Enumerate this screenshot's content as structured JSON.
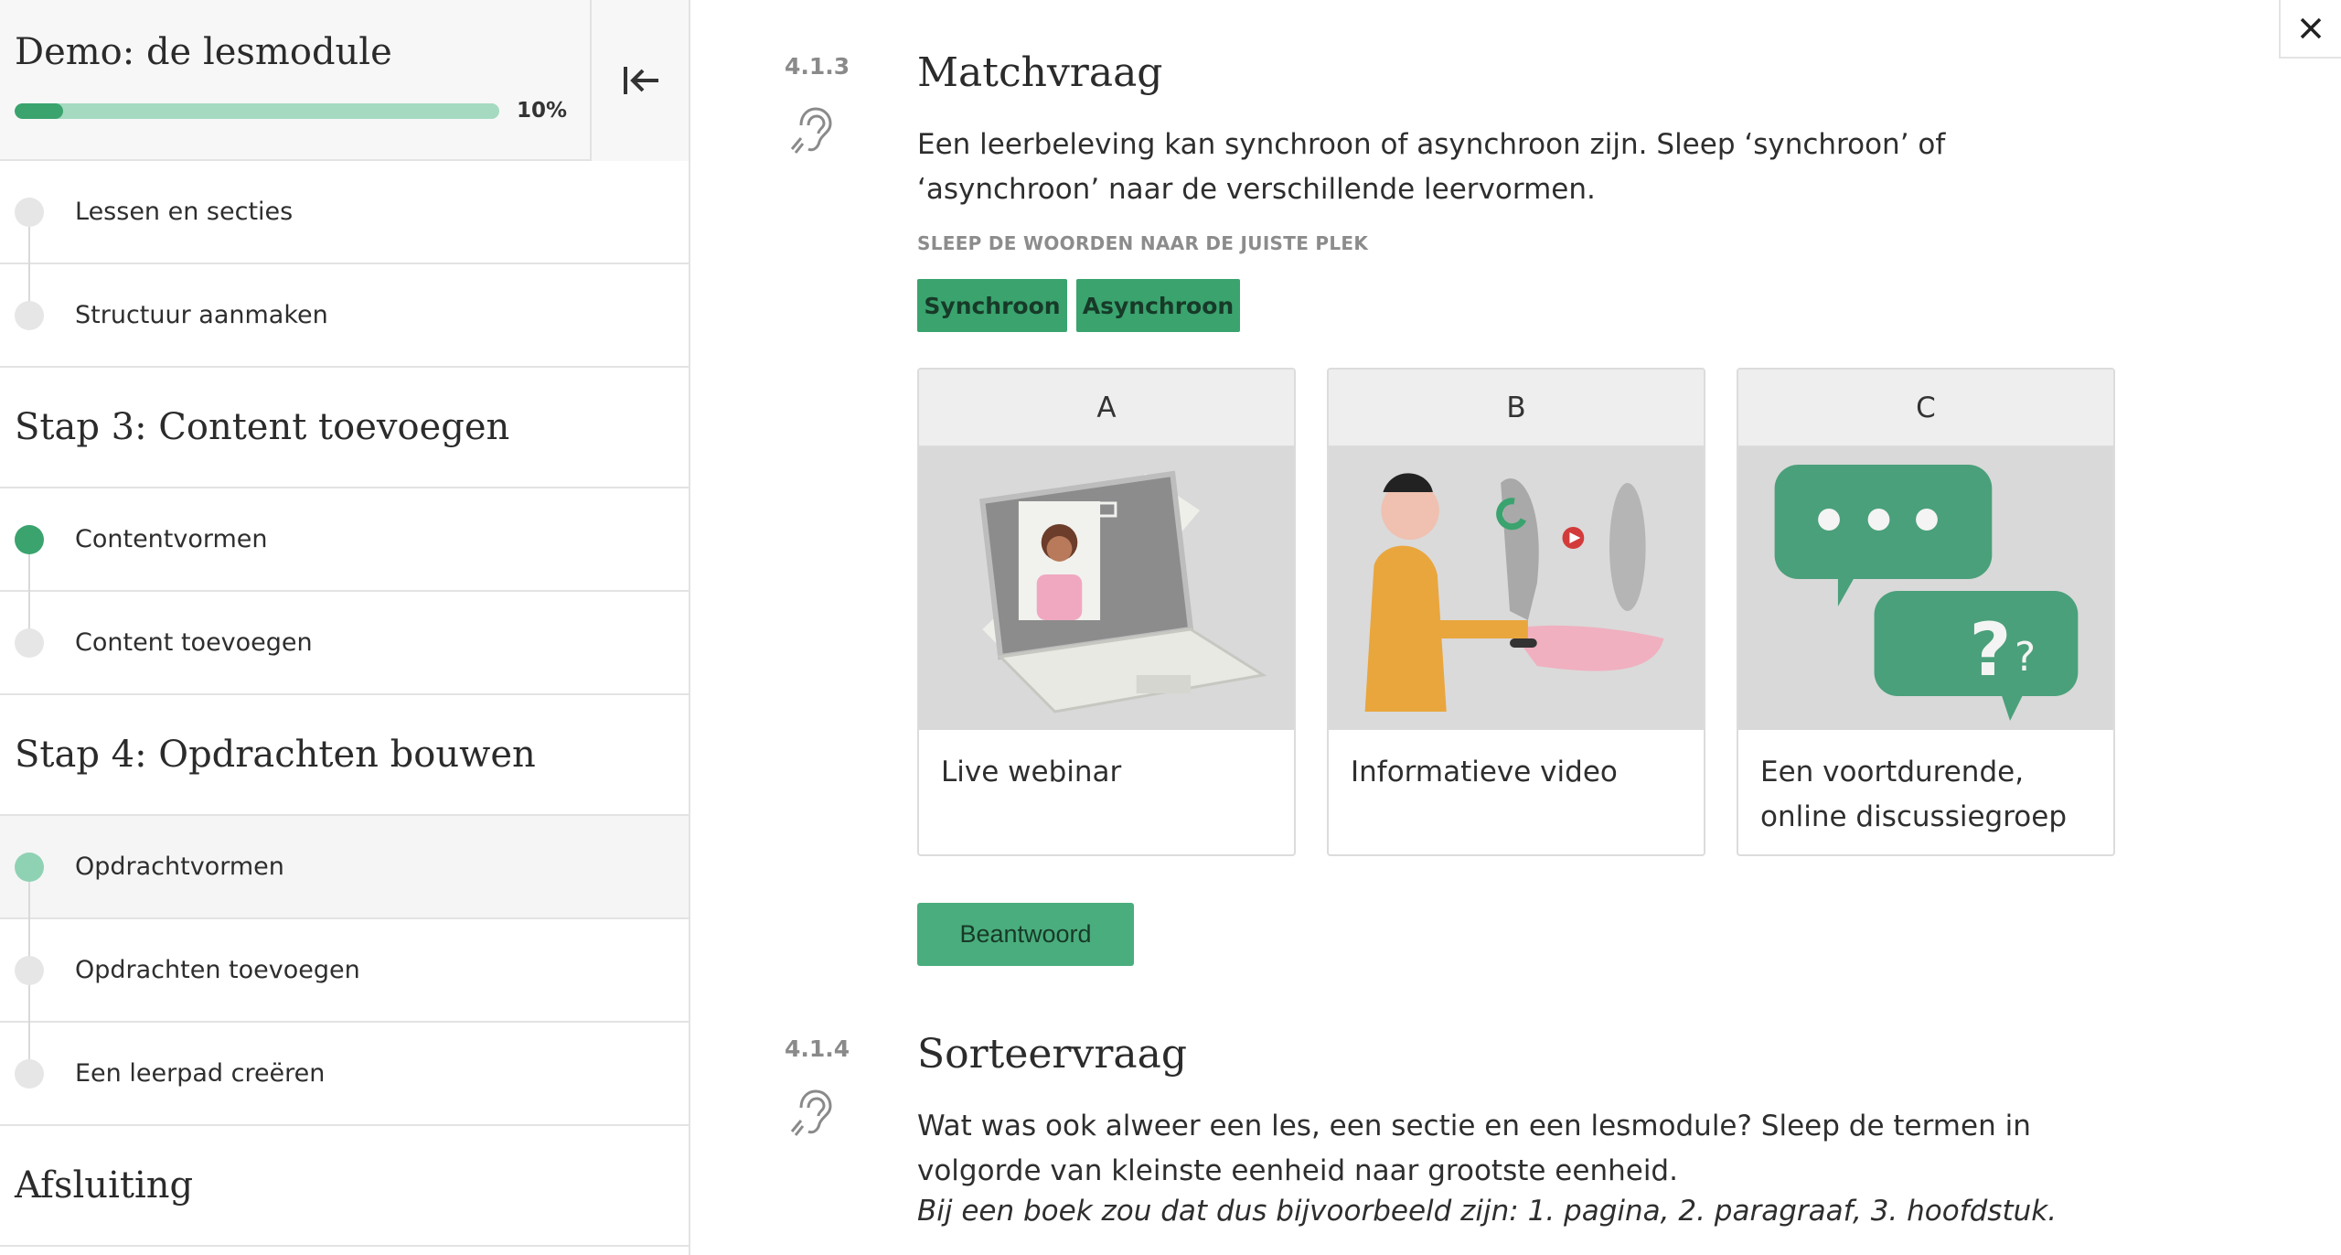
{
  "sidebar": {
    "title": "Demo: de lesmodule",
    "progress": {
      "value": 0.1,
      "label": "10%"
    },
    "collapse_icon": "collapse-left-icon",
    "items": [
      {
        "type": "lesson",
        "label": "Lessen en secties",
        "status": "todo"
      },
      {
        "type": "lesson",
        "label": "Structuur aanmaken",
        "status": "todo"
      },
      {
        "type": "section",
        "label": "Stap 3: Content toevoegen"
      },
      {
        "type": "lesson",
        "label": "Contentvormen",
        "status": "done"
      },
      {
        "type": "lesson",
        "label": "Content toevoegen",
        "status": "todo"
      },
      {
        "type": "section",
        "label": "Stap 4: Opdrachten bouwen"
      },
      {
        "type": "lesson",
        "label": "Opdrachtvormen",
        "status": "current"
      },
      {
        "type": "lesson",
        "label": "Opdrachten toevoegen",
        "status": "todo"
      },
      {
        "type": "lesson",
        "label": "Een leerpad creëren",
        "status": "todo"
      },
      {
        "type": "section",
        "label": "Afsluiting"
      }
    ]
  },
  "close_icon": "close-icon",
  "questions": [
    {
      "number": "4.1.3",
      "title": "Matchvraag",
      "text": "Een leerbeleving kan synchroon of asynchroon zijn. Sleep ‘synchroon’ of ‘asynchroon’ naar de verschillende leervormen.",
      "hint": "SLEEP DE WOORDEN NAAR DE JUISTE PLEK",
      "tags": [
        "Synchroon",
        "Asynchroon"
      ],
      "cards": [
        {
          "letter": "A",
          "label": "Live webinar",
          "image": "laptop-video-call-illustration"
        },
        {
          "letter": "B",
          "label": "Informatieve video",
          "image": "man-at-computer-video-illustration"
        },
        {
          "letter": "C",
          "label": "Een voortdurende, online discussiegroep",
          "image": "chat-bubbles-illustration"
        }
      ],
      "answer_button": "Beantwoord"
    },
    {
      "number": "4.1.4",
      "title": "Sorteervraag",
      "text": "Wat was ook alweer een les, een sectie en een lesmodule? Sleep de termen in volgorde van kleinste eenheid naar grootste eenheid.",
      "example": "Bij een boek zou dat dus bijvoorbeeld zijn: 1. pagina, 2. paragraaf, 3. hoofdstuk."
    }
  ],
  "colors": {
    "accent": "#3aa36e",
    "accent_light": "#a5dac0",
    "current": "#8fd2b3"
  }
}
